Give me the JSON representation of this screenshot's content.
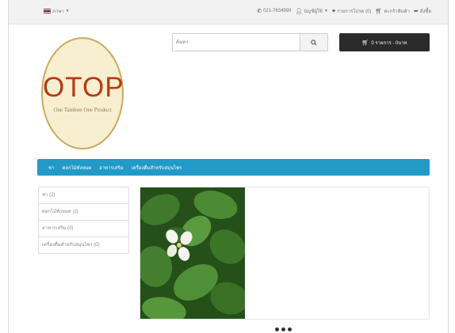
{
  "topbar": {
    "language_label": "ภาษา",
    "phone": "021-7634999",
    "account": "บัญชีผู้ใช้",
    "wishlist": "รายการโปรด (0)",
    "cart_link": "ตะกร้าสินค้า",
    "checkout": "สั่งซื้อ"
  },
  "logo": {
    "main": "OTOP",
    "sub": "One Tambon One Product"
  },
  "search": {
    "placeholder": "ค้นหา"
  },
  "cart": {
    "label": "0 รายการ - 0บาท"
  },
  "nav": {
    "items": [
      "ชา",
      "ดอกไม้ทั่งหมด",
      "อาหารเสริม",
      "เครื่องดื่มสำหรับสมุนไพร"
    ]
  },
  "sidebar": {
    "categories": [
      "ชา (2)",
      "ดอกไม้ทั่งหมด (2)",
      "อาหารเสริม (0)",
      "เครื่องดื่มสำหรับสมุนไพร (0)"
    ]
  },
  "colors": {
    "nav": "#229ac8",
    "cart_button": "#2b2b2b",
    "logo_text": "#b73a16"
  },
  "icons": {
    "phone": "phone-icon",
    "user": "user-icon",
    "heart": "heart-icon",
    "cart": "cart-icon",
    "share": "share-icon",
    "search": "search-icon"
  },
  "carousel": {
    "slides": 3
  }
}
